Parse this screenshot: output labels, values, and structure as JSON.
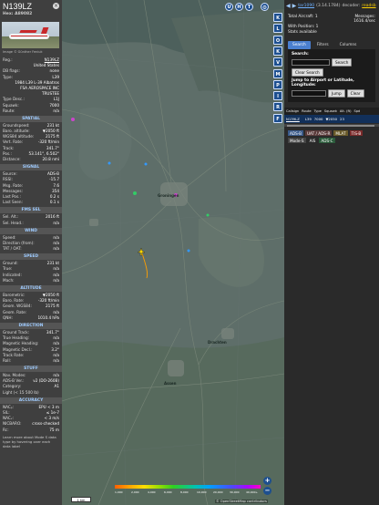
{
  "aircraft": {
    "callsign": "N139LZ",
    "hex_line": "Hex: A89082",
    "photo_credit": "Image © Günther Feniuk",
    "fields": [
      {
        "k": "Reg.:",
        "v": "N139LZ",
        "link": true
      },
      {
        "k": "",
        "v": "United States"
      },
      {
        "k": "DB flags:",
        "v": "none"
      },
      {
        "k": "Type:",
        "v": "L39"
      }
    ],
    "desc_line1": "1984 L39 L-39 Albatros",
    "desc_line2": "FSA AEROSPACE INC",
    "desc_line3": "TRUSTEE",
    "fields2": [
      {
        "k": "Type Desc.:",
        "v": "L1J"
      },
      {
        "k": "Squawk:",
        "v": "7000"
      },
      {
        "k": "Route:",
        "v": "n/a"
      }
    ]
  },
  "sections": [
    {
      "title": "SPATIAL",
      "rows": [
        {
          "k": "Groundspeed:",
          "v": "231 kt"
        },
        {
          "k": "Baro. altitude:",
          "v": "▼2050 ft"
        },
        {
          "k": "WGS84 altitude:",
          "v": "2175 ft"
        },
        {
          "k": "Vert. Rate:",
          "v": "-320 ft/min"
        },
        {
          "k": "Track:",
          "v": "341.7°"
        },
        {
          "k": "Pos.:",
          "v": "53.141°, 6.502°"
        },
        {
          "k": "Distance:",
          "v": "20.8 nmi"
        }
      ]
    },
    {
      "title": "SIGNAL",
      "rows": [
        {
          "k": "Source:",
          "v": "ADS-B"
        },
        {
          "k": "RSSI:",
          "v": "-15.7"
        },
        {
          "k": "Msg. Rate:",
          "v": "7.6"
        },
        {
          "k": "Messages:",
          "v": "354"
        },
        {
          "k": "Last Pos.:",
          "v": "0.2 s"
        },
        {
          "k": "Last Seen:",
          "v": "0.1 s"
        }
      ]
    },
    {
      "title": "FMS SEL",
      "rows": [
        {
          "k": "Sel. Alt.:",
          "v": "2016 ft"
        },
        {
          "k": "Sel. Head.:",
          "v": "n/a"
        }
      ]
    },
    {
      "title": "WIND",
      "rows": [
        {
          "k": "Speed:",
          "v": "n/a"
        },
        {
          "k": "Direction (from):",
          "v": "n/a"
        },
        {
          "k": "TAT / OAT:",
          "v": "n/a"
        }
      ]
    },
    {
      "title": "SPEED",
      "rows": [
        {
          "k": "Ground:",
          "v": "231 kt"
        },
        {
          "k": "True:",
          "v": "n/a"
        },
        {
          "k": "Indicated:",
          "v": "n/a"
        },
        {
          "k": "Mach:",
          "v": "n/a"
        }
      ]
    },
    {
      "title": "ALTITUDE",
      "rows": [
        {
          "k": "Barometric:",
          "v": "▼2050 ft"
        },
        {
          "k": "Baro. Rate:",
          "v": "-320 ft/min"
        },
        {
          "k": "Geom. WGS84:",
          "v": "2175 ft"
        },
        {
          "k": "Geom. Rate:",
          "v": "n/a"
        },
        {
          "k": "QNH:",
          "v": "1010.4 hPa"
        }
      ]
    },
    {
      "title": "DIRECTION",
      "rows": [
        {
          "k": "Ground Track:",
          "v": "341.7°"
        },
        {
          "k": "True Heading:",
          "v": "n/a"
        },
        {
          "k": "Magnetic Heading:",
          "v": "n/a"
        },
        {
          "k": "Magnetic Decl.:",
          "v": "3.2°"
        },
        {
          "k": "Track Rate:",
          "v": "n/a"
        },
        {
          "k": "Roll:",
          "v": "n/a"
        }
      ]
    },
    {
      "title": "STUFF",
      "rows": [
        {
          "k": "Nav. Modes:",
          "v": "n/a"
        },
        {
          "k": "ADS-B Ver.:",
          "v": "v2 (DO-260B)"
        },
        {
          "k": "Category:",
          "v": "A1"
        },
        {
          "k": "Light (< 15 500 lb)",
          "v": ""
        }
      ]
    },
    {
      "title": "ACCURACY",
      "rows": [
        {
          "k": "NACₚ:",
          "v": "EPU < 3 m"
        },
        {
          "k": "SIL:",
          "v": "≤ 1e-7"
        },
        {
          "k": "NACᵥ:",
          "v": "< 3 m/s"
        },
        {
          "k": "NICBARO:",
          "v": "cross-checked"
        },
        {
          "k": "Rc:",
          "v": "75 m"
        }
      ]
    }
  ],
  "learn_more": "Learn more about Mode S data type by hovering over each data label",
  "map": {
    "top_buttons": [
      "U",
      "H",
      "T"
    ],
    "side_buttons": [
      "K",
      "L",
      "O",
      "K",
      "V",
      "M",
      "P",
      "I",
      "R",
      "F"
    ],
    "labels": [
      "Groningen",
      "Assen",
      "Drachten"
    ],
    "alt_ticks": [
      "1,000",
      "2,000",
      "4,000",
      "6,000",
      "8,000",
      "10,000",
      "20,000",
      "30,000",
      "40,000+"
    ],
    "scale": "1 km",
    "attribution": "© OpenStreetMap contributors",
    "zoom_in": "+",
    "zoom_out": "−",
    "colors": {
      "selected_plane": "#ffd700",
      "track": "#ff9f00"
    }
  },
  "sidebar": {
    "link": "tar1090",
    "version": "(3.14.1784)",
    "decoder": "decoder:",
    "decoder_status": "readsb",
    "total_label": "Total Aircraft: 1",
    "messages_label": "Messages:",
    "messages_rate": "1616.4/sec",
    "with_position": "With Position: 1",
    "stats": "Stats available",
    "tabs": [
      "Search",
      "Filters",
      "Columns"
    ],
    "search_label": "Search:",
    "search_btn": "Search",
    "clear_search": "Clear Search",
    "jump_label": "Jump to Airport or Latitude, Longitude:",
    "jump_btn": "Jump",
    "clear_btn": "Clear",
    "columns": [
      "Callsign",
      "Route",
      "Type",
      "Squawk",
      "Alt. (ft)",
      "Spd"
    ],
    "row": [
      "N139LZ",
      "",
      "L39",
      "7000",
      "▼2050",
      "23"
    ],
    "badges": [
      {
        "t": "ADS-B",
        "c": "#3a5a8a"
      },
      {
        "t": "UAT / ADS-R",
        "c": "#5a3a3a"
      },
      {
        "t": "MLAT",
        "c": "#6a5a2a"
      },
      {
        "t": "TIS-B",
        "c": "#7a2a2a"
      },
      {
        "t": "Mode-S",
        "c": "#444444"
      },
      {
        "t": "AIS",
        "c": "#2a2a2a"
      },
      {
        "t": "ADS-C",
        "c": "#2a5a3a"
      }
    ]
  }
}
